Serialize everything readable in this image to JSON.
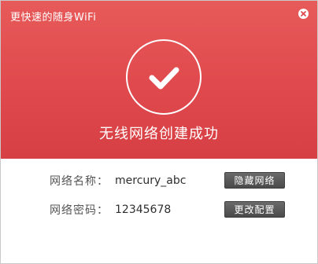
{
  "window": {
    "title": "更快速的随身WiFi"
  },
  "status": {
    "message": "无线网络创建成功"
  },
  "network": {
    "name_label": "网络名称：",
    "name_value": "mercury_abc",
    "password_label": "网络密码：",
    "password_value": "12345678"
  },
  "buttons": {
    "hide_network": "隐藏网络",
    "change_config": "更改配置"
  },
  "colors": {
    "header_red": "#e0494d",
    "button_gray": "#555555"
  },
  "icons": {
    "close": "close-circle-icon",
    "success": "check-circle-icon"
  }
}
